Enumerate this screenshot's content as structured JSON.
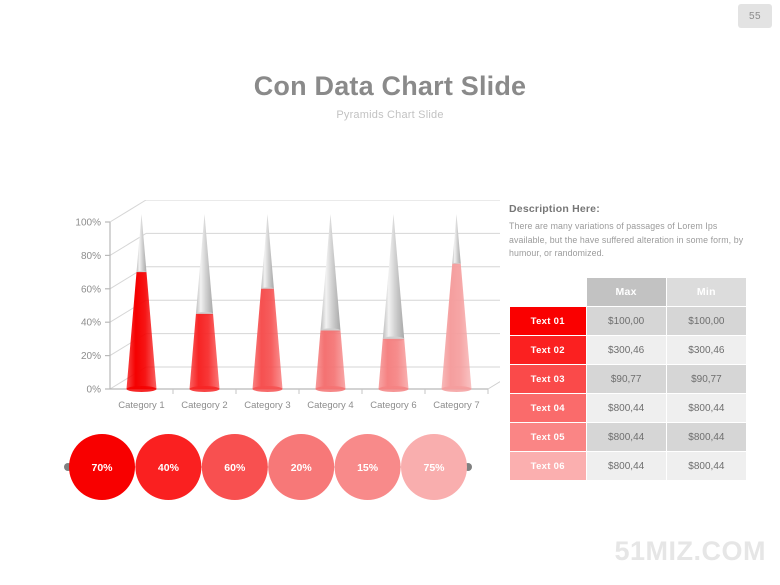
{
  "slide": {
    "number": "55",
    "title": "Con Data Chart Slide",
    "subtitle": "Pyramids Chart Slide",
    "watermark": "51MIZ.COM"
  },
  "description": {
    "heading": "Description Here:",
    "body": "There are many  variations of passages   of Lorem Ips available, but the have suffered  alteration in some form, by humour,  or randomized."
  },
  "chart_data": {
    "type": "bar",
    "subtype": "3d-cone",
    "title": "Con Data Chart Slide",
    "xlabel": "",
    "ylabel": "",
    "ylim": [
      0,
      100
    ],
    "grid": true,
    "legend": "none",
    "tick_labels": [
      "0%",
      "20%",
      "40%",
      "60%",
      "80%",
      "100%"
    ],
    "tick_values": [
      0,
      20,
      40,
      60,
      80,
      100
    ],
    "categories": [
      "Category 1",
      "Category 2",
      "Category 3",
      "Category 4",
      "Category 6",
      "Category 7"
    ],
    "values": [
      70,
      45,
      60,
      35,
      30,
      75
    ],
    "colors": [
      "#f50000",
      "#f72525",
      "#f65050",
      "#f47272",
      "#f58282",
      "#f59e9e"
    ],
    "unfilled_color": "#d8d8d8"
  },
  "circles": {
    "items": [
      {
        "label": "70%",
        "value": 70,
        "color": "#f80000"
      },
      {
        "label": "40%",
        "value": 40,
        "color": "#fa2020"
      },
      {
        "label": "60%",
        "value": 60,
        "color": "#f85050"
      },
      {
        "label": "20%",
        "value": 20,
        "color": "#f77878"
      },
      {
        "label": "15%",
        "value": 15,
        "color": "#f88a8a"
      },
      {
        "label": "75%",
        "value": 75,
        "color": "#f9aeae"
      }
    ],
    "connector_color": "#d9d9d9",
    "end_dot_color": "#808080"
  },
  "table": {
    "headers": [
      "",
      "Max",
      "Min"
    ],
    "rows": [
      {
        "label": "Text 01",
        "max": "$100,00",
        "min": "$100,00",
        "color": "#fa0000"
      },
      {
        "label": "Text 02",
        "max": "$300,46",
        "min": "$300,46",
        "color": "#fb2020"
      },
      {
        "label": "Text 03",
        "max": "$90,77",
        "min": "$90,77",
        "color": "#fa4a4a"
      },
      {
        "label": "Text 04",
        "max": "$800,44",
        "min": "$800,44",
        "color": "#fa6b6b"
      },
      {
        "label": "Text 05",
        "max": "$800,44",
        "min": "$800,44",
        "color": "#fa8585"
      },
      {
        "label": "Text 06",
        "max": "$800,44",
        "min": "$800,44",
        "color": "#fbafaf"
      }
    ]
  }
}
